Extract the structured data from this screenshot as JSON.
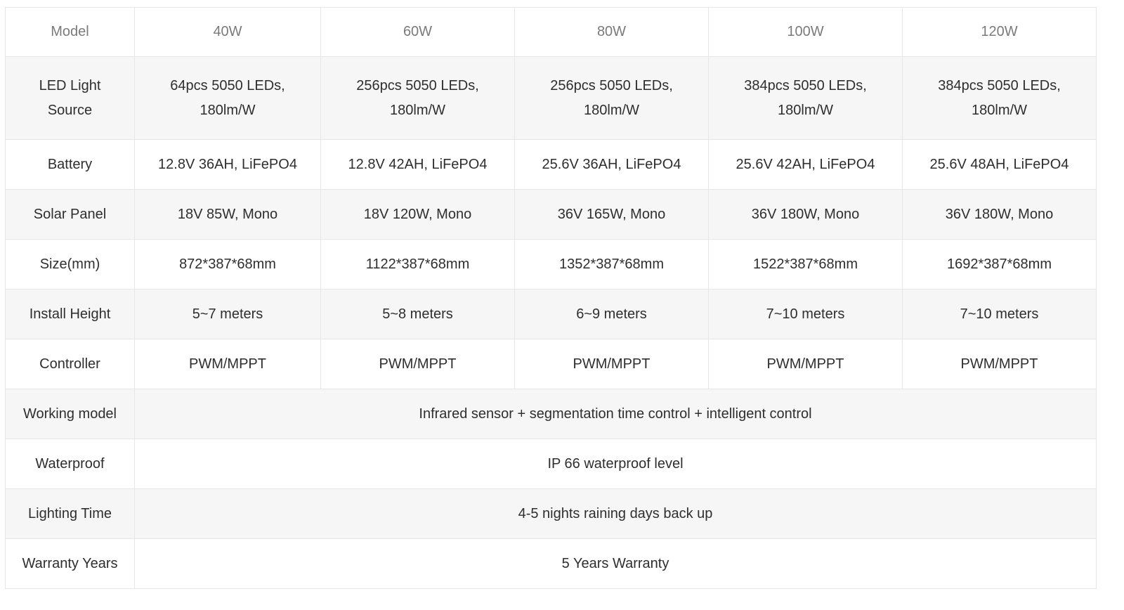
{
  "table": {
    "header": {
      "label": "Model",
      "values": [
        "40W",
        "60W",
        "80W",
        "100W",
        "120W"
      ]
    },
    "rows": [
      {
        "label_lines": [
          "LED Light",
          "Source"
        ],
        "values": [
          [
            "64pcs 5050 LEDs,",
            "180lm/W"
          ],
          [
            "256pcs 5050 LEDs,",
            "180lm/W"
          ],
          [
            "256pcs 5050 LEDs,",
            "180lm/W"
          ],
          [
            "384pcs 5050 LEDs,",
            "180lm/W"
          ],
          [
            "384pcs 5050 LEDs,",
            "180lm/W"
          ]
        ]
      },
      {
        "label": "Battery",
        "values": [
          "12.8V 36AH, LiFePO4",
          "12.8V 42AH, LiFePO4",
          "25.6V 36AH, LiFePO4",
          "25.6V 42AH, LiFePO4",
          "25.6V 48AH, LiFePO4"
        ]
      },
      {
        "label": "Solar Panel",
        "values": [
          "18V 85W, Mono",
          "18V 120W, Mono",
          "36V 165W, Mono",
          "36V 180W, Mono",
          "36V 180W, Mono"
        ]
      },
      {
        "label": "Size(mm)",
        "values": [
          "872*387*68mm",
          "1122*387*68mm",
          "1352*387*68mm",
          "1522*387*68mm",
          "1692*387*68mm"
        ]
      },
      {
        "label": "Install Height",
        "values": [
          "5~7 meters",
          "5~8 meters",
          "6~9 meters",
          "7~10 meters",
          "7~10 meters"
        ]
      },
      {
        "label": "Controller",
        "values": [
          "PWM/MPPT",
          "PWM/MPPT",
          "PWM/MPPT",
          "PWM/MPPT",
          "PWM/MPPT"
        ]
      },
      {
        "label": "Working model",
        "merged": "Infrared sensor + segmentation time control + intelligent control"
      },
      {
        "label": "Waterproof",
        "merged": "IP 66 waterproof level"
      },
      {
        "label": "Lighting Time",
        "merged": "4-5 nights raining days back up"
      },
      {
        "label": "Warranty Years",
        "merged": "5 Years Warranty"
      }
    ]
  },
  "colors": {
    "row_alt_background": "#f6f6f6",
    "border": "#e6e6e6",
    "header_text": "#7a7a7a",
    "body_text": "#2e2e2e"
  }
}
